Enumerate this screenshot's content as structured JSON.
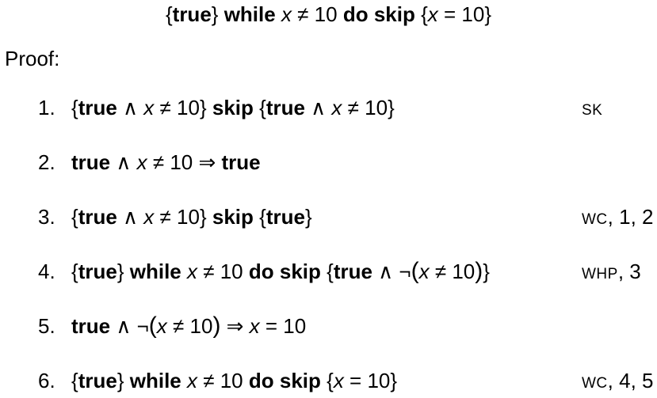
{
  "title": {
    "open": "{",
    "true": "true",
    "close": "}",
    "while": "while",
    "x": "x",
    "neq10": " ≠ 10 ",
    "do": "do",
    "skip": "skip",
    "post_open": " {",
    "post_x": "x",
    "post_eq": " = 10",
    "post_close": "}"
  },
  "proof_label": "Proof:",
  "steps": [
    {
      "num": "1.",
      "justification": "SK",
      "just_rest": ""
    },
    {
      "num": "2.",
      "justification": "",
      "just_rest": ""
    },
    {
      "num": "3.",
      "justification": "WC",
      "just_rest": ", 1, 2"
    },
    {
      "num": "4.",
      "justification": "WHP",
      "just_rest": ", 3"
    },
    {
      "num": "5.",
      "justification": "",
      "just_rest": ""
    },
    {
      "num": "6.",
      "justification": "WC",
      "just_rest": ", 4, 5"
    }
  ],
  "tokens": {
    "true": "true",
    "skip": "skip",
    "while": "while",
    "do": "do",
    "x": "x",
    "and": " ∧ ",
    "not": "¬",
    "neq10": " ≠ 10",
    "eq10": " = 10",
    "implies": " ⇒ ",
    "lbrace": "{",
    "rbrace": "}",
    "lparen": "(",
    "rparen": ")"
  }
}
